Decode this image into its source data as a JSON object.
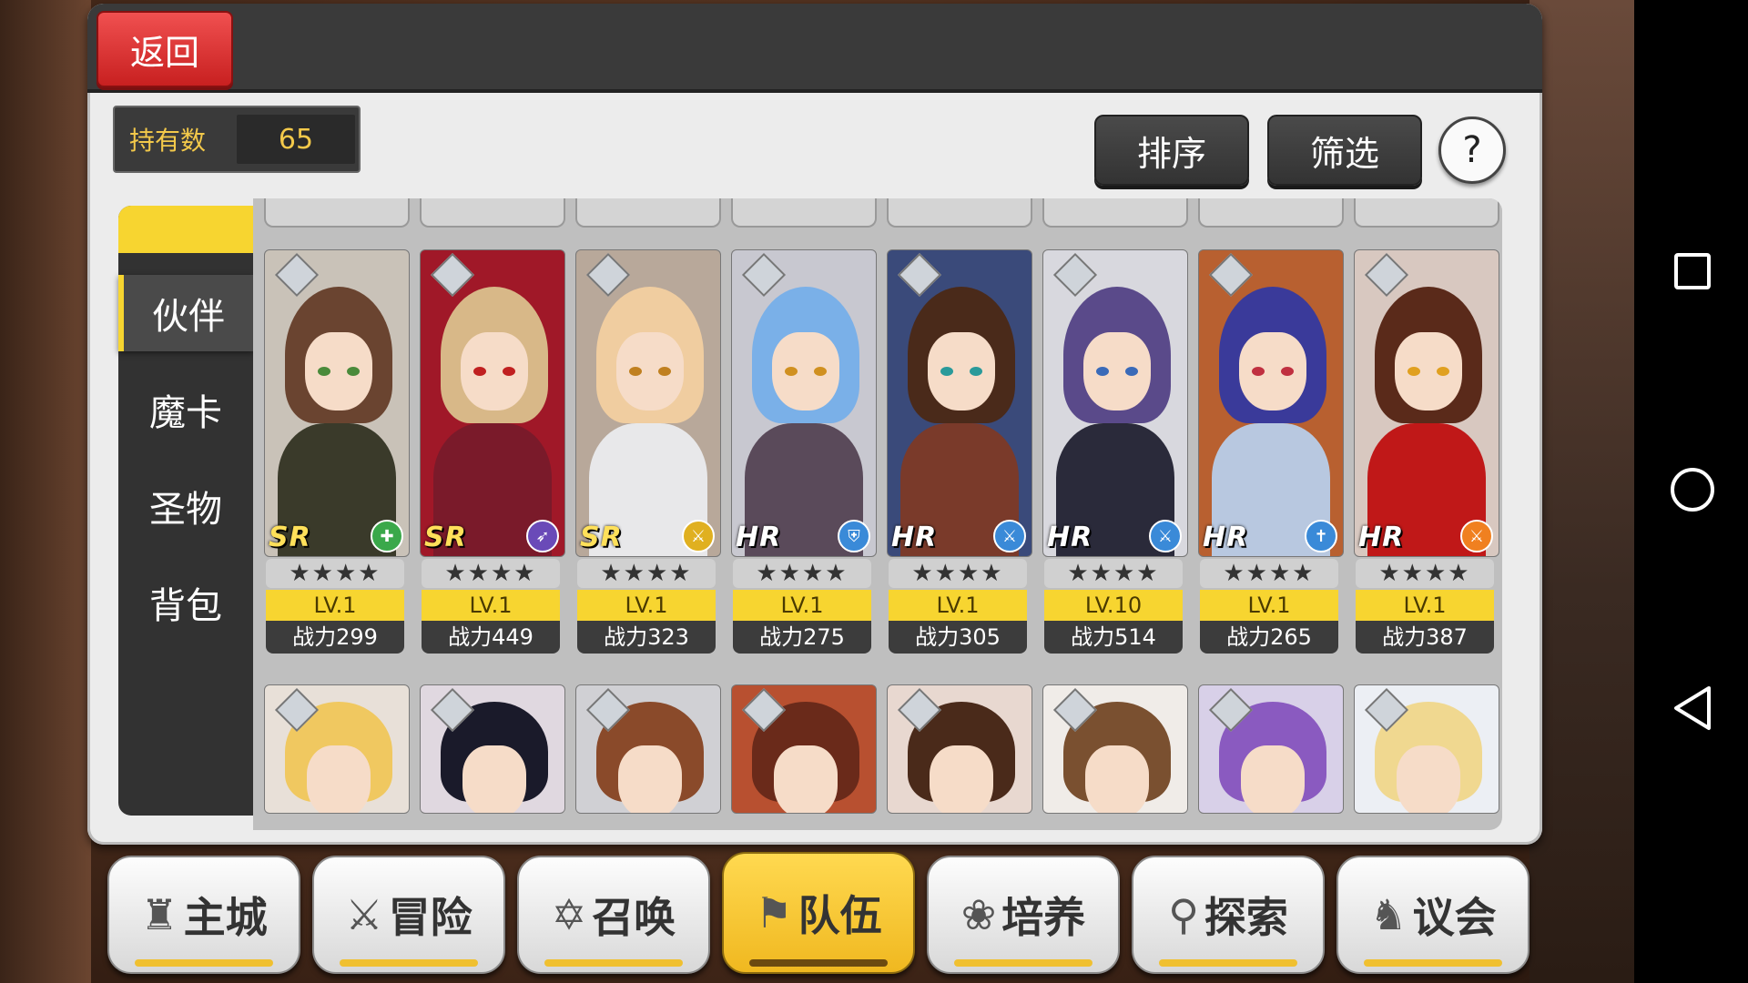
{
  "header": {
    "back_label": "返回"
  },
  "holdings": {
    "label": "持有数",
    "value": "65"
  },
  "toolbar": {
    "sort_label": "排序",
    "filter_label": "筛选",
    "help_label": "?"
  },
  "tabs": [
    {
      "label": "伙伴",
      "active": true
    },
    {
      "label": "魔卡",
      "active": false
    },
    {
      "label": "圣物",
      "active": false
    },
    {
      "label": "背包",
      "active": false
    }
  ],
  "stars_glyph": "★★★★",
  "characters": [
    {
      "rarity": "SR",
      "role_icon": "healer-icon",
      "role_color": "#3aa84a",
      "level": "LV.1",
      "power": "战力299",
      "hair": "#6a4430",
      "outfit": "#3a3a2a",
      "bg": "#c9c2b8",
      "eye": "#4a8a3a"
    },
    {
      "rarity": "SR",
      "role_icon": "bow-icon",
      "role_color": "#6a4ab8",
      "level": "LV.1",
      "power": "战力449",
      "hair": "#d8b888",
      "outfit": "#7a1a2a",
      "bg": "#a01828",
      "eye": "#c02020"
    },
    {
      "rarity": "SR",
      "role_icon": "sword-icon",
      "role_color": "#e0b020",
      "level": "LV.1",
      "power": "战力323",
      "hair": "#f0cda0",
      "outfit": "#e8e8ea",
      "bg": "#b8a89a",
      "eye": "#c08020"
    },
    {
      "rarity": "HR",
      "role_icon": "shield-icon",
      "role_color": "#3a8ad8",
      "level": "LV.1",
      "power": "战力275",
      "hair": "#7ab0e8",
      "outfit": "#5a4a5a",
      "bg": "#c8c8d0",
      "eye": "#d09020"
    },
    {
      "rarity": "HR",
      "role_icon": "sword-icon",
      "role_color": "#3a8ad8",
      "level": "LV.1",
      "power": "战力305",
      "hair": "#4a2a1a",
      "outfit": "#7a3a2a",
      "bg": "#3a4a7a",
      "eye": "#2a9a9a"
    },
    {
      "rarity": "HR",
      "role_icon": "sword-icon",
      "role_color": "#3a8ad8",
      "level": "LV.10",
      "power": "战力514",
      "hair": "#5a4a8a",
      "outfit": "#2a2a3a",
      "bg": "#d8d8de",
      "eye": "#3a6ab8"
    },
    {
      "rarity": "HR",
      "role_icon": "cross-icon",
      "role_color": "#3a8ad8",
      "level": "LV.1",
      "power": "战力265",
      "hair": "#3a3a9a",
      "outfit": "#b8c8e0",
      "bg": "#b86030",
      "eye": "#c03040"
    },
    {
      "rarity": "HR",
      "role_icon": "sword-icon",
      "role_color": "#f08020",
      "level": "LV.1",
      "power": "战力387",
      "hair": "#5a2a1a",
      "outfit": "#c01818",
      "bg": "#d8c8c0",
      "eye": "#e0a020"
    }
  ],
  "row2": [
    {
      "hair": "#f0c860",
      "bg": "#e8e0d8"
    },
    {
      "hair": "#1a1a2a",
      "bg": "#e0d8e0"
    },
    {
      "hair": "#8a4a2a",
      "bg": "#d0d0d4"
    },
    {
      "hair": "#6a2a1a",
      "bg": "#b85030"
    },
    {
      "hair": "#4a2a1a",
      "bg": "#e8d8d0"
    },
    {
      "hair": "#7a5030",
      "bg": "#f0ece8"
    },
    {
      "hair": "#8a5ac0",
      "bg": "#d8d0e8"
    },
    {
      "hair": "#f0d890",
      "bg": "#eceff4"
    }
  ],
  "bottom_nav": [
    {
      "label": "主城",
      "icon": "castle-icon",
      "glyph": "♜",
      "active": false
    },
    {
      "label": "冒险",
      "icon": "crossed-swords-icon",
      "glyph": "⚔",
      "active": false
    },
    {
      "label": "召唤",
      "icon": "hexagram-icon",
      "glyph": "✡",
      "active": false
    },
    {
      "label": "队伍",
      "icon": "team-icon",
      "glyph": "⚑",
      "active": true
    },
    {
      "label": "培养",
      "icon": "nurture-icon",
      "glyph": "❀",
      "active": false
    },
    {
      "label": "探索",
      "icon": "explore-icon",
      "glyph": "⚲",
      "active": false
    },
    {
      "label": "议会",
      "icon": "council-icon",
      "glyph": "♞",
      "active": false
    }
  ]
}
